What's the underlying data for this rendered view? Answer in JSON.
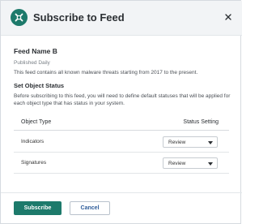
{
  "dialog": {
    "title": "Subscribe to Feed",
    "logo_icon": "shield-x-icon",
    "close_icon": "close-icon"
  },
  "feed": {
    "name": "Feed Name B",
    "frequency": "Published Daily",
    "description": "This feed contains all known malware threats starting from 2017 to the present."
  },
  "object_status": {
    "section_title": "Set Object Status",
    "section_description": "Before subscribing to this feed, you will need to define default statuses that will be applied for each object type that has status in your system.",
    "columns": [
      "Object Type",
      "Status Setting"
    ],
    "rows": [
      {
        "type": "Indicators",
        "status": "Review"
      },
      {
        "type": "Signatures",
        "status": "Review"
      }
    ]
  },
  "footer": {
    "subscribe_label": "Subscribe",
    "cancel_label": "Cancel"
  },
  "colors": {
    "primary": "#1d7a6b",
    "link": "#2f5d9a"
  }
}
